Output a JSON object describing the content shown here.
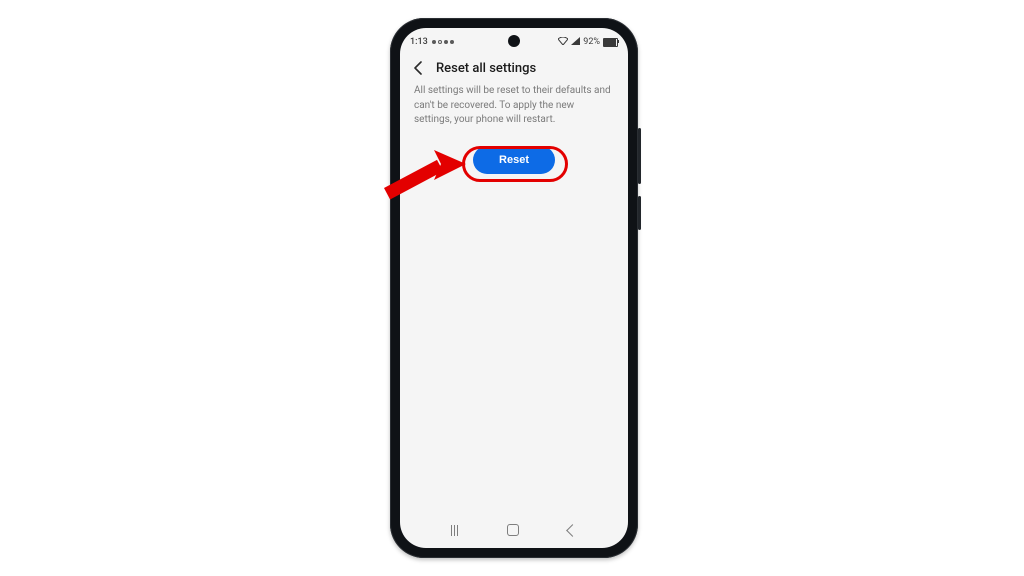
{
  "statusbar": {
    "time": "1:13",
    "battery_pct": "92%"
  },
  "appbar": {
    "title": "Reset all settings"
  },
  "body": {
    "description": "All settings will be reset to their defaults and can't be recovered. To apply the new settings, your phone will restart."
  },
  "actions": {
    "reset_label": "Reset"
  },
  "annotation": {
    "arrow_color": "#e30000",
    "highlight_color": "#e30000"
  }
}
